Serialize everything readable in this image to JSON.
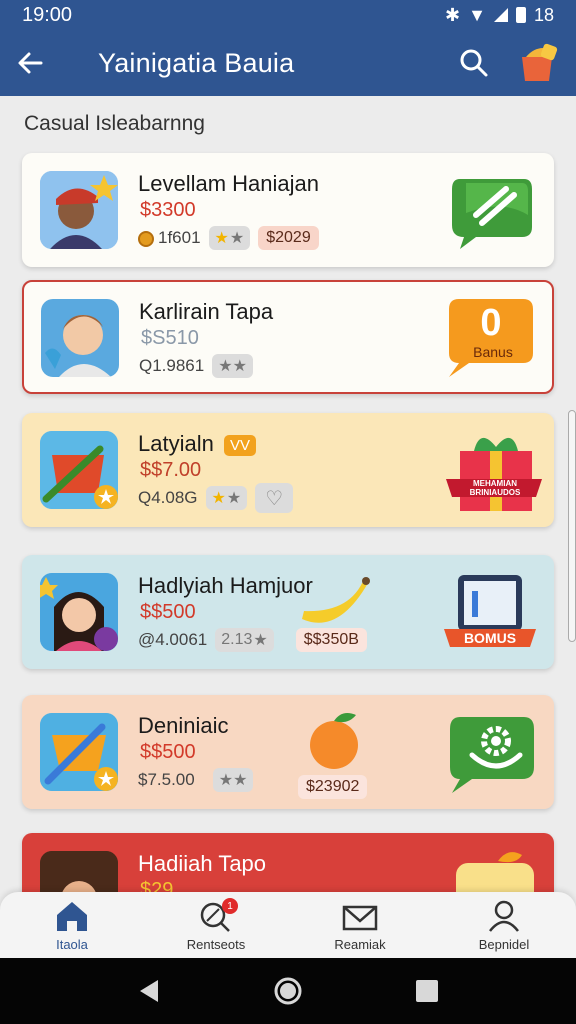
{
  "status": {
    "time": "19:00",
    "battery": "18"
  },
  "appbar": {
    "title": "Yainigatia Bauia"
  },
  "section_title": "Casual Isleabarnng",
  "cards": [
    {
      "name": "Levellam Haniajan",
      "price": "$3300",
      "coins": "1f601",
      "chip": "$2029",
      "bg": "#fdfcf7"
    },
    {
      "name": "Karlirain Tapa",
      "price": "$S510",
      "code": "Q1.9861",
      "action_num": "0",
      "action_label": "Banus",
      "bg": "#fdfcf7"
    },
    {
      "name": "Latyialn",
      "badge": "VV",
      "price": "$$7.00",
      "code": "Q4.08G",
      "gift_label": "MEHAMIAN BRINIAUDOS",
      "bg": "#fbe7b8"
    },
    {
      "name": "Hadlyiah Hamjuor",
      "price": "$$500",
      "code": "@4.0061",
      "stars_num": "2.13",
      "chip": "$$350B",
      "action_label": "BOMUS",
      "bg": "#cfe6ea"
    },
    {
      "name": "Deniniaic",
      "price": "$$500",
      "code": "$7.5.00",
      "chip": "$23902",
      "bg": "#f8d8c2"
    },
    {
      "name": "Hadiiah Tapo",
      "price": "$29",
      "bg": "#d8403a"
    }
  ],
  "nav": [
    {
      "label": "Itaola",
      "icon": "home-icon"
    },
    {
      "label": "Rentseots",
      "icon": "search-badge-icon",
      "badge": "1"
    },
    {
      "label": "Reamiak",
      "icon": "mail-icon"
    },
    {
      "label": "Bepnidel",
      "icon": "person-icon"
    }
  ],
  "colors": {
    "appbar": "#2f5591",
    "accent_red": "#d23a2a"
  }
}
